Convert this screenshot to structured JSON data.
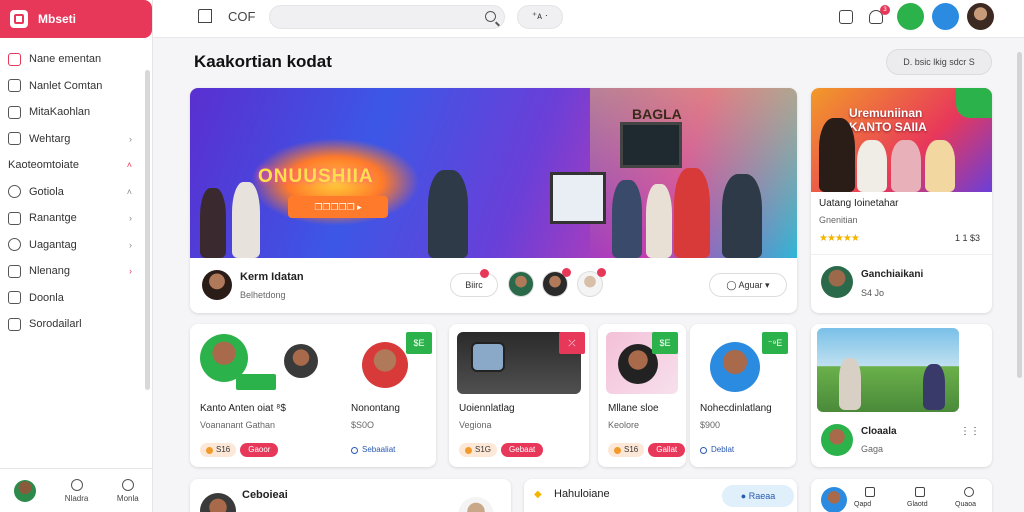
{
  "brand": {
    "name": "Mbseti"
  },
  "sidebar": {
    "items": [
      {
        "label": "Nane ementan",
        "icon": "heart-icon",
        "chevron": ""
      },
      {
        "label": "Nanlet Comtan",
        "icon": "square-icon",
        "chevron": ""
      },
      {
        "label": "MitaKaohlan",
        "icon": "mail-icon",
        "chevron": ""
      },
      {
        "label": "Wehtarg",
        "icon": "doc-icon",
        "chevron": "›"
      },
      {
        "label": "Kaoteomtoiate",
        "icon": "none",
        "chevron": "˄"
      },
      {
        "label": "Gotiola",
        "icon": "globe-icon",
        "chevron": "˄"
      },
      {
        "label": "Ranantge",
        "icon": "doc-icon",
        "chevron": "›"
      },
      {
        "label": "Uagantag",
        "icon": "clock-icon",
        "chevron": "›"
      },
      {
        "label": "Nlenang",
        "icon": "list-icon",
        "chevron": "›"
      },
      {
        "label": "Doonla",
        "icon": "grid-icon",
        "chevron": ""
      },
      {
        "label": "Sorodailarl",
        "icon": "folder-icon",
        "chevron": ""
      }
    ],
    "bottom": {
      "btn1": "Nladra",
      "btn2": "Monla"
    }
  },
  "topbar": {
    "cof": "COF",
    "search_placeholder": "",
    "pill": "⁺ᴀ ⋅",
    "bell_badge": "3"
  },
  "main": {
    "title": "Kaakortian kodat",
    "sort": "D. bsic lkig sdcr S"
  },
  "hero": {
    "neon_text": "ONUUSHIIA",
    "banner_btn": "❐❐❐❐❐ ▸",
    "wall_text": "BAGLA",
    "author": "Kerm Idatan",
    "sub": "Belhetdong",
    "pill": "Biirc",
    "button": "Aguar"
  },
  "side": {
    "img_text": "Uremuniinan\nKANTO SAIIA",
    "title": "Uatang Ioinetahar",
    "sub": "Gnenitian",
    "stars": "★★★★★",
    "num": "1 1 $3",
    "author": "Ganchiaikani",
    "author_sub": "S4 Jo"
  },
  "grid": [
    {
      "title": "Kanto Anten oiat ⁸$",
      "sub": "Voananant Gathan",
      "chip1": "S16",
      "chip2": "Gaoor",
      "tag": "$E"
    },
    {
      "title": "Nonontang",
      "sub": "$S0O",
      "chip1": "",
      "chip2": "Sebaaliat",
      "tag": "S E"
    },
    {
      "title": "Uoiennlatlag",
      "sub": "Vegiona",
      "chip1": "S1G",
      "chip2": "Gebaat",
      "tag": "⤫"
    },
    {
      "title": "Mllane sloe",
      "sub": "Keolore",
      "chip1": "S16",
      "chip2": "Gallat",
      "tag": "$E"
    },
    {
      "title": "Nohecdinlatlang",
      "sub": "$900",
      "chip1": "",
      "chip2": "Deblat",
      "tag": "⁻⁹E"
    },
    {
      "title": "Cloaala",
      "sub": "Gaga",
      "chip1": "",
      "chip2": "",
      "tag": ""
    }
  ],
  "bottom_row": {
    "card1": "Ceboieai",
    "card2": "Hahuloiane",
    "card2_btn": "Raeaa",
    "card3_labels": [
      "Qapd",
      "Glaotd",
      "Quaoa"
    ]
  },
  "colors": {
    "accent": "#e8385a",
    "green": "#2cb24a",
    "blue": "#2a8be0"
  }
}
